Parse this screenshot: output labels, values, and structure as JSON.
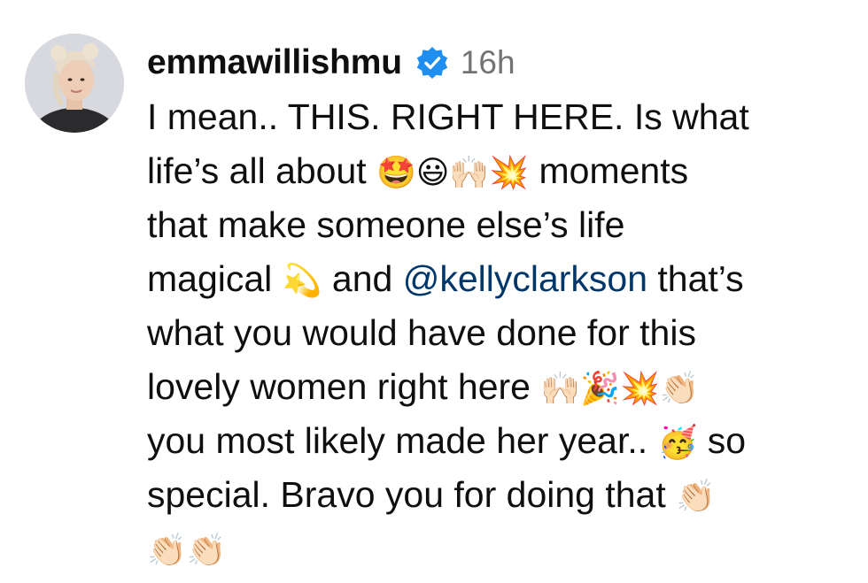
{
  "post": {
    "username": "emmawillishmu",
    "timestamp": "16h",
    "verified_color": "#1f8ef1",
    "caption_lines": [
      {
        "before": "I mean.. THIS. RIGHT HERE. Is what",
        "emoji": "",
        "after": ""
      },
      {
        "before": "life’s all about ",
        "emoji": "🤩😃🙌🏻💥",
        "after": " moments"
      },
      {
        "before": "that make someone else’s life",
        "emoji": "",
        "after": ""
      },
      {
        "before": "magical ",
        "emoji": "💫",
        "after": " and "
      },
      {
        "before": "what you would have done for this",
        "emoji": "",
        "after": ""
      },
      {
        "before": "lovely women right here ",
        "emoji": "🙌🏻🎉💥👏🏻",
        "after": ""
      },
      {
        "before": "you most likely made her year.. ",
        "emoji": "🥳",
        "after": " so"
      },
      {
        "before": "special. Bravo you for doing that ",
        "emoji": "👏🏻",
        "after": ""
      },
      {
        "before": "",
        "emoji": "👏🏻👏🏻",
        "after": ""
      }
    ],
    "mention": "@kellyclarkson",
    "mention_after": " that’s",
    "mention_color": "#00376b"
  }
}
